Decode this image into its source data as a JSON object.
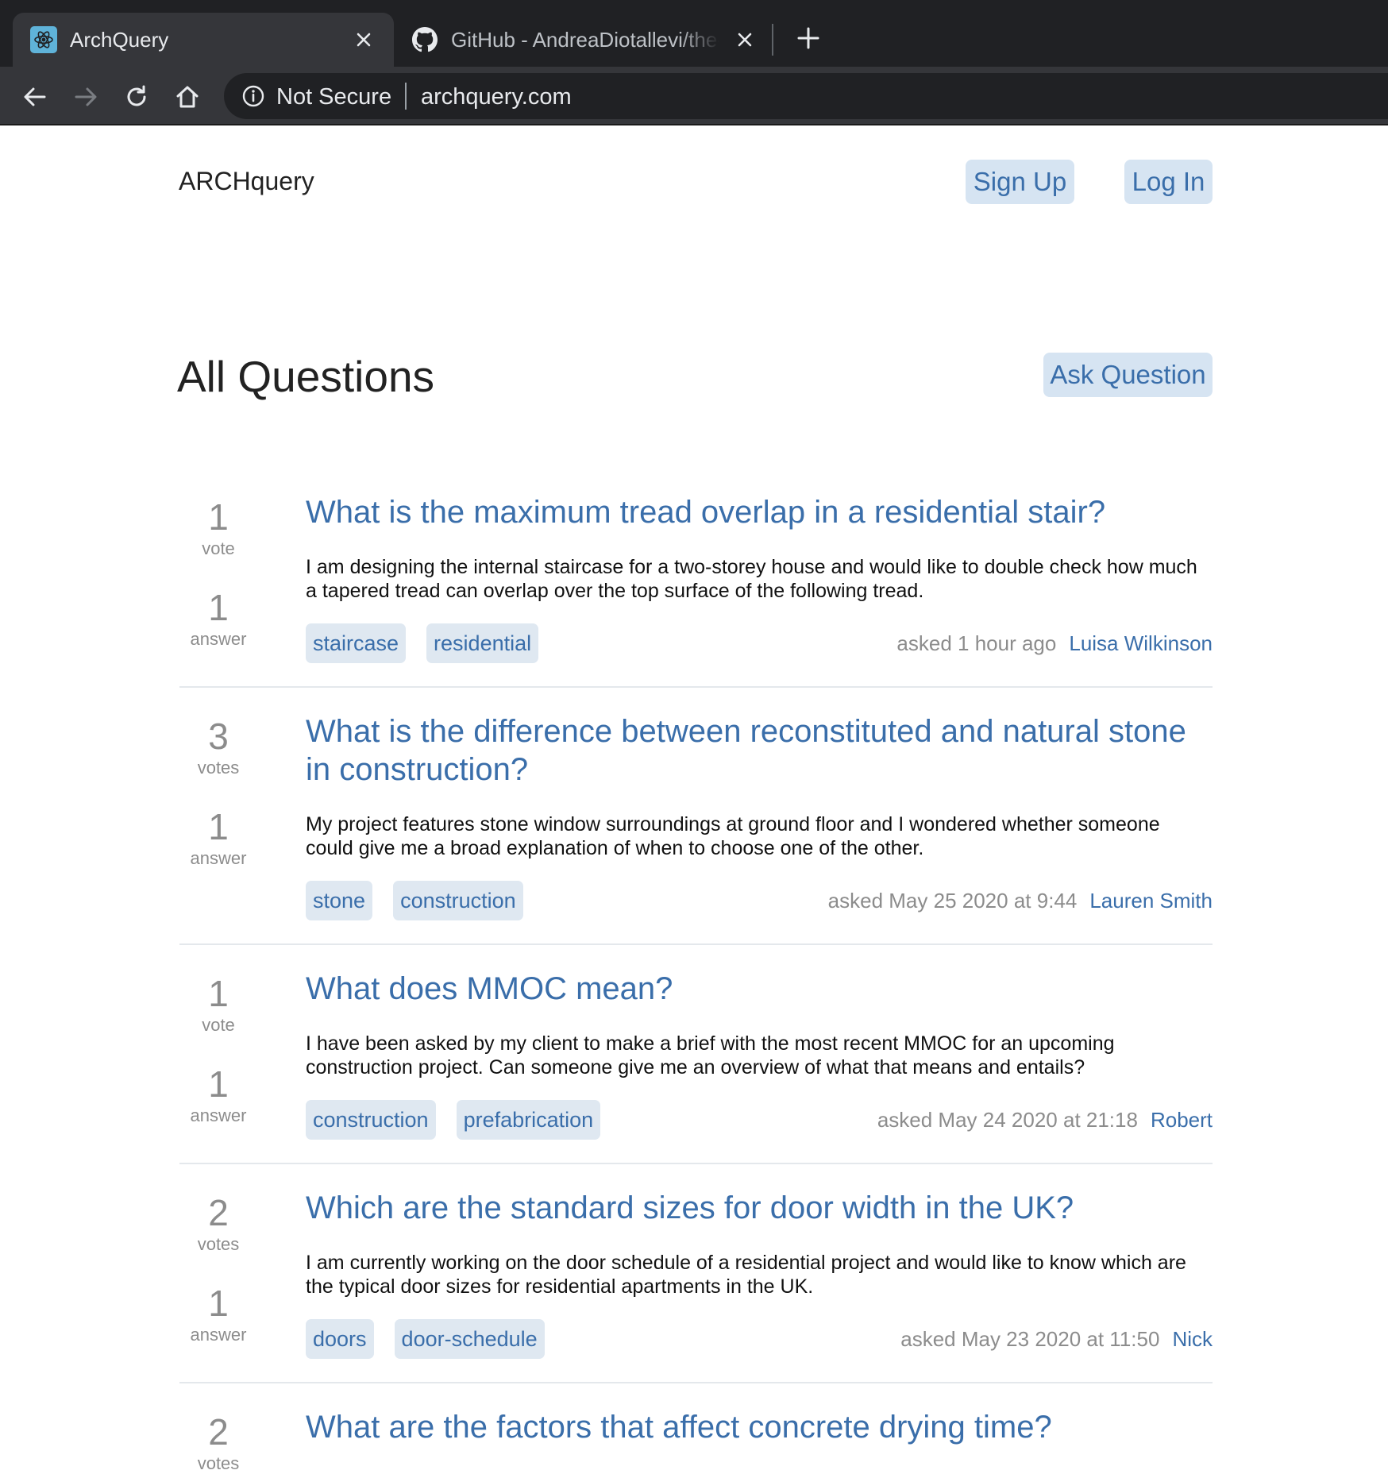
{
  "browser": {
    "tabs": [
      {
        "title": "ArchQuery",
        "favicon": "react-icon",
        "active": true
      },
      {
        "title": "GitHub - AndreaDiotallevi/the-f",
        "favicon": "github-icon",
        "active": false
      }
    ],
    "security_label": "Not Secure",
    "url": "archquery.com"
  },
  "header": {
    "brand": "ARCHquery",
    "signup_label": "Sign Up",
    "login_label": "Log In"
  },
  "main": {
    "title": "All Questions",
    "ask_label": "Ask Question",
    "questions": [
      {
        "votes": "1",
        "votes_label": "vote",
        "answers": "1",
        "answers_label": "answer",
        "title": "What is the maximum tread overlap in a residential stair?",
        "body": "I am designing the internal staircase for a two-storey house and would like to double check how much a tapered tread can overlap over the top surface of the following tread.",
        "tags": [
          "staircase",
          "residential"
        ],
        "asked": "asked 1 hour ago",
        "author": "Luisa Wilkinson"
      },
      {
        "votes": "3",
        "votes_label": "votes",
        "answers": "1",
        "answers_label": "answer",
        "title": "What is the difference between reconstituted and natural stone in construction?",
        "body": "My project features stone window surroundings at ground floor and I wondered whether someone could give me a broad explanation of when to choose one of the other.",
        "tags": [
          "stone",
          "construction"
        ],
        "asked": "asked May 25 2020 at 9:44",
        "author": "Lauren Smith"
      },
      {
        "votes": "1",
        "votes_label": "vote",
        "answers": "1",
        "answers_label": "answer",
        "title": "What does MMOC mean?",
        "body": "I have been asked by my client to make a brief with the most recent MMOC for an upcoming construction project. Can someone give me an overview of what that means and entails?",
        "tags": [
          "construction",
          "prefabrication"
        ],
        "asked": "asked May 24 2020 at 21:18",
        "author": "Robert"
      },
      {
        "votes": "2",
        "votes_label": "votes",
        "answers": "1",
        "answers_label": "answer",
        "title": "Which are the standard sizes for door width in the UK?",
        "body": "I am currently working on the door schedule of a residential project and would like to know which are the typical door sizes for residential apartments in the UK.",
        "tags": [
          "doors",
          "door-schedule"
        ],
        "asked": "asked May 23 2020 at 11:50",
        "author": "Nick"
      },
      {
        "votes": "2",
        "votes_label": "votes",
        "answers": "",
        "answers_label": "",
        "title": "What are the factors that affect concrete drying time?",
        "body": "",
        "tags": [],
        "asked": "",
        "author": ""
      }
    ]
  },
  "colors": {
    "link": "#3a6eaa",
    "button_bg": "#d6e4f2",
    "tag_bg": "#dfe8f1",
    "muted": "#8c8c8c",
    "chrome_dark": "#202124",
    "chrome_toolbar": "#35363a"
  }
}
